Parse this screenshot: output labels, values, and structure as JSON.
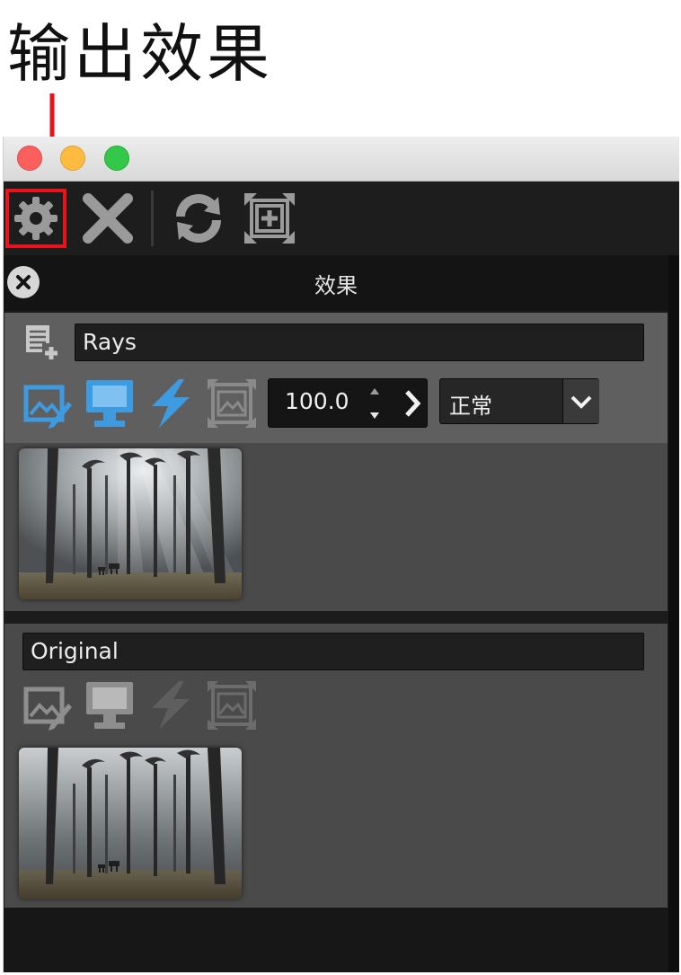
{
  "heading": "输出效果",
  "window": {
    "traffic_lights": [
      "close",
      "minimize",
      "zoom"
    ],
    "toolbar": {
      "buttons": [
        {
          "name": "settings",
          "icon": "gear-icon",
          "highlighted": true,
          "highlight_color": "#e8141b"
        },
        {
          "name": "close",
          "icon": "x-icon"
        },
        {
          "name": "refresh",
          "icon": "refresh-icon"
        },
        {
          "name": "fit",
          "icon": "fit-frame-icon"
        }
      ]
    },
    "panel": {
      "title": "效果",
      "layers": [
        {
          "name": "Rays",
          "selected": true,
          "opacity": "100.0",
          "blend_mode": "正常",
          "icons": [
            "edit-mask-icon",
            "monitor-icon",
            "lightning-icon",
            "frame-image-icon"
          ],
          "icons_active": [
            true,
            true,
            true,
            false
          ]
        },
        {
          "name": "Original",
          "selected": false,
          "icons": [
            "edit-mask-icon",
            "monitor-icon",
            "lightning-icon",
            "frame-image-icon"
          ],
          "icons_active": [
            false,
            false,
            false,
            false
          ]
        }
      ]
    }
  },
  "colors": {
    "accent_blue": "#3f9be0",
    "highlight_red": "#e8141b",
    "panel_bg": "#4a4a4a",
    "selected_layer_bg": "#5f5f5f"
  }
}
